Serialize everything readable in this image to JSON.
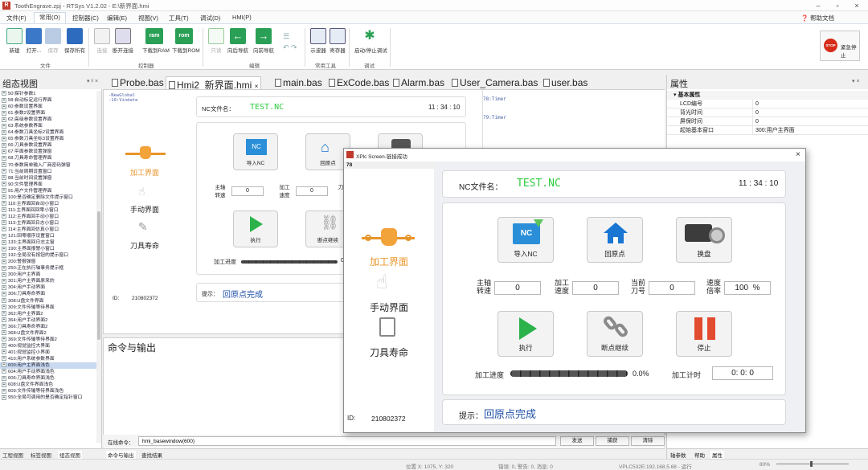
{
  "titlebar": {
    "title": "ToothEngrave.zpj - RTSys V1.2.02 - E:\\新界面.hmi"
  },
  "menu": {
    "items": [
      "文件(F)",
      "常用(O)",
      "控制器(C)",
      "编辑(E)",
      "视图(V)",
      "工具(T)",
      "调试(D)",
      "HMI(P)"
    ],
    "help": "帮助文档"
  },
  "ribbon": {
    "file": [
      "新建",
      "打开...",
      "保存",
      "保存所有"
    ],
    "controller": [
      "连接",
      "断开连接",
      "下载到RAM",
      "下载到ROM"
    ],
    "edit": [
      "只读",
      "向后导航",
      "向前导航"
    ],
    "tools": [
      "示波器",
      "寄存器"
    ],
    "debug": [
      "启动/停止调试"
    ],
    "groups": {
      "file": "文件",
      "controller": "控制器",
      "edit": "编辑",
      "tools": "常用工具",
      "debug": "调试"
    },
    "icons": {
      "ram": "ram",
      "rom": "rom"
    },
    "estop": {
      "label": "紧急停止",
      "icon_text": "STOP"
    }
  },
  "left_panel": {
    "title": "组态视图",
    "items": [
      "50:探针参数1",
      "58:自动标定运行界面",
      "60:参数设置界面",
      "61:参数2设置界面",
      "62:高级参数设置界面",
      "63:系统参数界面",
      "64:参数刀具坐标2设置界面",
      "65:参数刀具坐标3设置界面",
      "66:刀具参数设置界面",
      "67:平面参数设置弹窗",
      "68:刀具寿命管理界面",
      "70:参数简单输入厂商密码弹窗",
      "71:当前周期设置窗口",
      "88:当前时间设置弹窗",
      "90:文件管理界面",
      "91:用户文件管理界面",
      "100:是否确定删除文件提示窗口",
      "110:主界面回自动小窗口",
      "111:主界面回回零小窗口",
      "112:主界面回手动小窗口",
      "113:主界面回日志小窗口",
      "114:主界面回仿真小窗口",
      "121:回零顺序设置窗口",
      "133:主界面回日志主窗",
      "190:主界面报警小窗口",
      "192:全局没有按钮的提示窗口",
      "200:警报弹窗",
      "250:正在执行轴事务提示框",
      "300:用户主界面",
      "301:用户主界面原来的",
      "304:用户手动界面",
      "306:刀具寿命界面",
      "308:U盘文件界面",
      "309:文件传输等待界面",
      "362:用户主界面2",
      "364:用户手动界面2",
      "366:刀具寿命界面2",
      "368:U盘文件界面2",
      "369:文件传输等待界面2",
      "400:视觉监控大界面",
      "401:视觉监控小界面",
      "410:用户系统参数界面",
      "600:用户主界面浅色",
      "604:用户手动界面浅色",
      "606:刀具寿命界面浅色",
      "608:U盘文件界面浅色",
      "609:文件传输等待界面浅色",
      "950:全局可调用的是否确定指针窗口"
    ],
    "selected_index": 42,
    "tabs": [
      "工程视图",
      "标签视图",
      "组态视图"
    ]
  },
  "doc_tabs": [
    "Probe.bas",
    "Hmi2_新界面.hmi",
    "main.bas",
    "ExCode.bas",
    "Alarm.bas",
    "User_Camera.bas",
    "user.bas"
  ],
  "doc_tab_close": "×",
  "editor": {
    "left_text": [
      "-NewGlobal",
      "-10:Vindate"
    ],
    "timers": [
      "78:Timer",
      "79:Timer"
    ]
  },
  "small_hmi": {
    "nc_label": "NC文件名：",
    "nc_value": "TEST.NC",
    "time": "11 : 34 : 10",
    "nav": [
      "加工界面",
      "手动界面",
      "刀具寿命"
    ],
    "btns": [
      "导入NC",
      "回原点",
      "执行",
      "断点继续"
    ],
    "spindle": "主轴转速",
    "feed": "加工速度",
    "knife": "刀",
    "zero": "0",
    "progress_label": "加工进度",
    "progress_value": "0",
    "hint_label": "提示：",
    "hint_value": "回原点完成",
    "id_label": "ID:",
    "id_value": "210802372"
  },
  "command": {
    "title": "命令与输出",
    "input_label": "在线命令：",
    "input_value": "hmi_basewindow(600)",
    "buttons": [
      "发送",
      "捕获",
      "清除"
    ],
    "tabs": [
      "命令与输出",
      "查找结果"
    ]
  },
  "properties": {
    "title": "属性",
    "category": "基本属性",
    "rows": [
      {
        "k": "LCD编号",
        "v": "0"
      },
      {
        "k": "背光时间",
        "v": "0"
      },
      {
        "k": "屏保时间",
        "v": "0"
      },
      {
        "k": "起始基本窗口",
        "v": "300:用户主界面"
      }
    ],
    "tabs": [
      "轴参数",
      "帮助",
      "属性"
    ]
  },
  "status": {
    "position": "位置 X: 1075, Y: 320",
    "errors": "错误: 0, 警告: 0, 消息: 0",
    "controller": "VPLC532E:192.168.5.68 - 运行",
    "zoom": "80%"
  },
  "xplc": {
    "title": "XPlc Screen-链接成功",
    "number": "78",
    "nc_label": "NC文件名：",
    "nc_value": "TEST.NC",
    "time": "11 : 34 : 10",
    "nav": [
      "加工界面",
      "手动界面",
      "刀具寿命"
    ],
    "buttons_top": [
      "导入NC",
      "回原点",
      "换盘"
    ],
    "buttons_bottom": [
      "执行",
      "断点继续",
      "停止"
    ],
    "nc_icon_text": "NC",
    "fields": [
      {
        "label": "主轴转速",
        "value": "0"
      },
      {
        "label": "加工速度",
        "value": "0"
      },
      {
        "label": "当前刀号",
        "value": "0"
      },
      {
        "label": "速度倍率",
        "value": "100",
        "unit": "%"
      }
    ],
    "progress_label": "加工进度",
    "progress_value": "0.0%",
    "timer_label": "加工计时",
    "timer_value": "0: 0: 0",
    "hint_label": "提示：",
    "hint_value": "回原点完成",
    "id_label": "ID:",
    "id_value": "210802372"
  },
  "colors": {
    "nc_green": "#2ecc40",
    "hint_blue": "#1f4fa8",
    "accent_orange": "#e8952a",
    "play_green": "#2bb24a",
    "stop_red": "#e24b2f",
    "house_blue": "#1976d2"
  }
}
